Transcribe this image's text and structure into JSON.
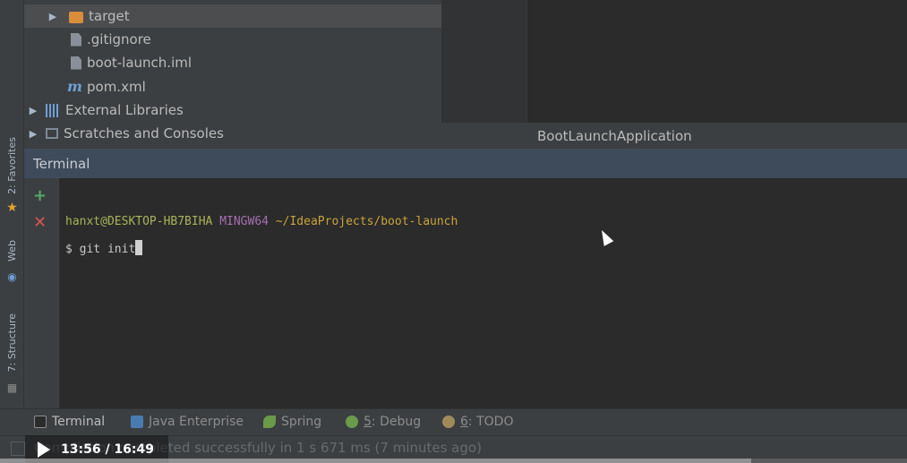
{
  "colors": {
    "prompt_user": "#a8b35a",
    "prompt_path": "#c9a33a",
    "terminal_text": "#c8c8c8",
    "add_green": "#59a869",
    "close_red": "#d9544f",
    "favorites_star": "#e2a52d"
  },
  "left_strip": {
    "favorites": "2: Favorites",
    "web": "Web",
    "structure": "7: Structure"
  },
  "project_tree": {
    "items": [
      {
        "label": "target",
        "icon": "folder-icon",
        "expanded": false
      },
      {
        "label": ".gitignore",
        "icon": "file-icon"
      },
      {
        "label": "boot-launch.iml",
        "icon": "file-icon"
      },
      {
        "label": "pom.xml",
        "icon": "maven-icon",
        "glyph": "m"
      },
      {
        "label": "External Libraries",
        "icon": "library-icon",
        "expanded": false
      },
      {
        "label": "Scratches and Consoles",
        "icon": "scratch-icon",
        "expanded": false
      }
    ]
  },
  "editor": {
    "run_config": "BootLaunchApplication"
  },
  "terminal": {
    "title": "Terminal",
    "add_glyph": "+",
    "close_glyph": "✕",
    "prompt_user": "hanxt@DESKTOP-HB7BIHA",
    "prompt_shell": "MINGW64",
    "prompt_path": "~/IdeaProjects/boot-launch",
    "command_prefix": "$",
    "command": "git init"
  },
  "bottom_tabs": [
    {
      "label": "Terminal",
      "icon": "terminal-icon",
      "active": true
    },
    {
      "label": "Java Enterprise",
      "icon": "java-enterprise-icon"
    },
    {
      "label": "Spring",
      "icon": "spring-icon"
    },
    {
      "key": "5",
      "label": ": Debug",
      "icon": "debug-icon"
    },
    {
      "key": "6",
      "label": ": TODO",
      "icon": "todo-icon"
    }
  ],
  "status": {
    "message": "Compilation completed successfully in 1 s 671 ms (7 minutes ago)"
  },
  "video": {
    "time": "13:56 / 16:49",
    "progress": 0.828
  }
}
